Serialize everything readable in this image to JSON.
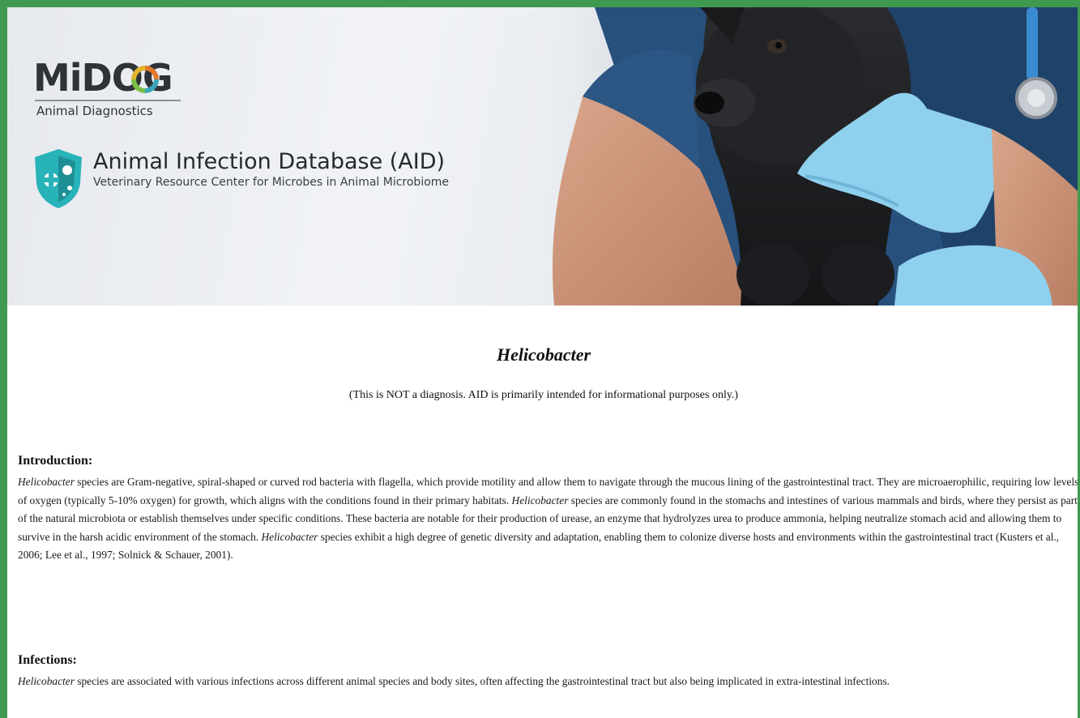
{
  "banner": {
    "logo_text": "MiDOG",
    "logo_sub": "Animal Diagnostics",
    "database_title": "Animal Infection Database (AID)",
    "database_subtitle": "Veterinary Resource Center for Microbes in Animal Microbiome"
  },
  "article": {
    "title": "Helicobacter",
    "disclaimer": "(This is NOT a diagnosis. AID is primarily intended for informational purposes only.)",
    "introduction": {
      "heading": "Introduction:",
      "segments": [
        {
          "t": "Helicobacter",
          "i": true
        },
        {
          "t": " species are Gram-negative, spiral-shaped or curved rod bacteria with flagella, which provide motility and allow them to navigate through the mucous lining of the gastrointestinal tract. They are microaerophilic, requiring low levels of oxygen (typically 5-10% oxygen) for growth, which aligns with the conditions found in their primary habitats. ",
          "i": false
        },
        {
          "t": "Helicobacter",
          "i": true
        },
        {
          "t": " species are commonly found in the stomachs and intestines of various mammals and birds, where they persist as part of the natural microbiota or establish themselves under specific conditions. These bacteria are notable for their production of urease, an enzyme that hydrolyzes urea to produce ammonia, helping neutralize stomach acid and allowing them to survive in the harsh acidic environment of the stomach. ",
          "i": false
        },
        {
          "t": "Helicobacter",
          "i": true
        },
        {
          "t": " species exhibit a high degree of genetic diversity and adaptation, enabling them to colonize diverse hosts and environments within the gastrointestinal tract (Kusters et al., 2006; Lee et al., 1997; Solnick & Schauer, 2001).",
          "i": false
        }
      ]
    },
    "infections": {
      "heading": "Infections:",
      "segments": [
        {
          "t": "Helicobacter",
          "i": true
        },
        {
          "t": " species are associated with various infections across different animal species and body sites, often affecting the gastrointestinal tract but also being implicated in extra-intestinal infections.",
          "i": false
        }
      ]
    }
  },
  "colors": {
    "frame_border": "#3f9a4f",
    "brand_teal": "#27b3b8",
    "glove_blue": "#8fd0ee",
    "scrubs_navy": "#274a73"
  }
}
